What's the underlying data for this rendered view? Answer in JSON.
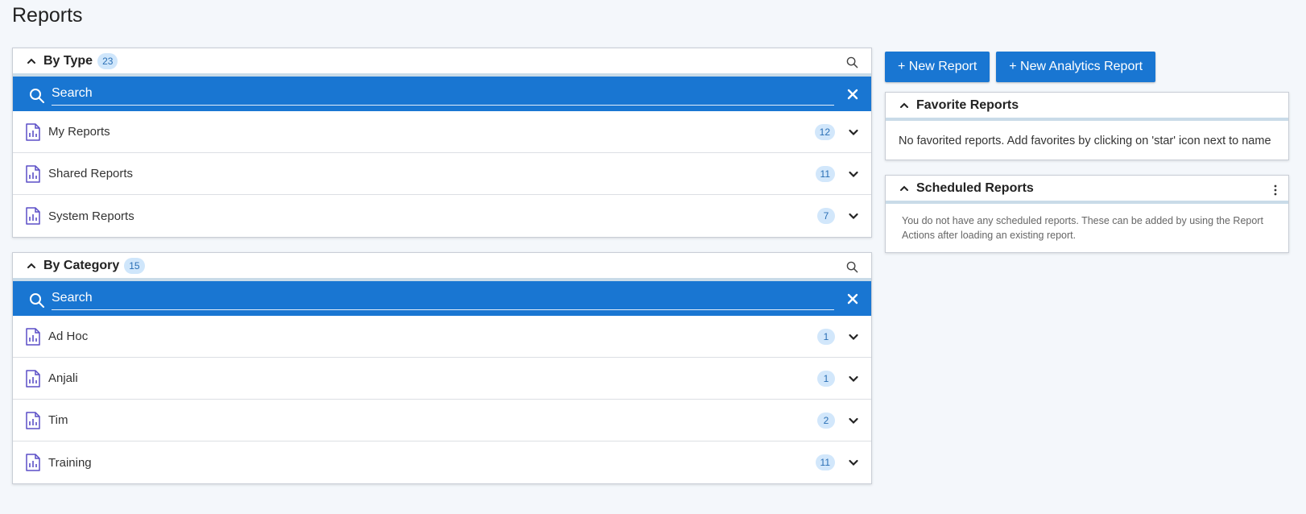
{
  "page": {
    "title": "Reports"
  },
  "by_type": {
    "title": "By Type",
    "count": "23",
    "search_placeholder": "Search",
    "items": [
      {
        "label": "My Reports",
        "count": "12"
      },
      {
        "label": "Shared Reports",
        "count": "11"
      },
      {
        "label": "System Reports",
        "count": "7"
      }
    ]
  },
  "by_category": {
    "title": "By Category",
    "count": "15",
    "search_placeholder": "Search",
    "items": [
      {
        "label": "Ad Hoc",
        "count": "1"
      },
      {
        "label": "Anjali",
        "count": "1"
      },
      {
        "label": "Tim",
        "count": "2"
      },
      {
        "label": "Training",
        "count": "11"
      }
    ]
  },
  "actions": {
    "new_report": "+ New Report",
    "new_analytics_report": "+ New Analytics Report"
  },
  "favorites": {
    "title": "Favorite Reports",
    "empty_text": "No favorited reports. Add favorites by clicking on 'star' icon next to name"
  },
  "scheduled": {
    "title": "Scheduled Reports",
    "empty_text": "You do not have any scheduled reports. These can be added by using the Report Actions after loading an existing report."
  },
  "colors": {
    "primary": "#1976d2",
    "badge_bg": "#d2e7fb",
    "badge_text": "#2a6fb5",
    "doc_icon": "#5b4fc7"
  },
  "icons": {
    "collapse": "chevron-up-icon",
    "expand": "chevron-down-icon",
    "search": "search-icon",
    "close": "close-icon",
    "report": "report-document-icon",
    "menu": "kebab-menu-icon"
  }
}
